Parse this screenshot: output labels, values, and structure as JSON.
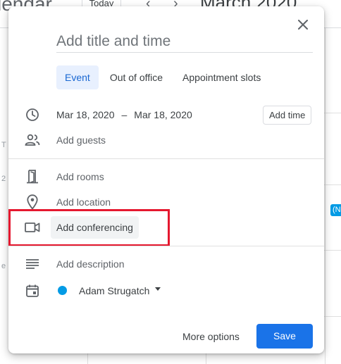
{
  "background": {
    "app_title": "lendar",
    "today_label": "Today",
    "prev_glyph": "‹",
    "next_glyph": "›",
    "month_label": "March 2020",
    "event_chip": "(N",
    "tiny_marks": [
      "T",
      "2",
      "e"
    ]
  },
  "dialog": {
    "title_placeholder": "Add title and time",
    "tabs": [
      {
        "label": "Event",
        "active": true
      },
      {
        "label": "Out of office",
        "active": false
      },
      {
        "label": "Appointment slots",
        "active": false
      }
    ],
    "date": {
      "start": "Mar 18, 2020",
      "separator": "–",
      "end": "Mar 18, 2020",
      "add_time_label": "Add time"
    },
    "guests_label": "Add guests",
    "rooms_label": "Add rooms",
    "location_label": "Add location",
    "conferencing_label": "Add conferencing",
    "description_label": "Add description",
    "calendar_owner": "Adam Strugatch",
    "calendar_color": "#039be5",
    "more_options_label": "More options",
    "save_label": "Save"
  },
  "colors": {
    "accent": "#1a73e8",
    "highlight": "#e5182f",
    "active_tab_bg": "#e8f0fe"
  }
}
